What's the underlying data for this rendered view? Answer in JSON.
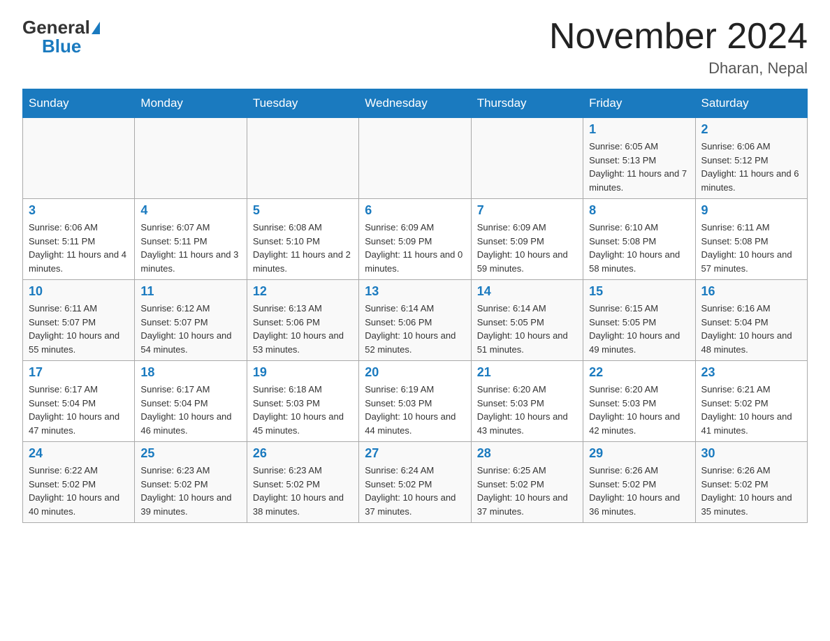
{
  "header": {
    "logo_text_general": "General",
    "logo_text_blue": "Blue",
    "month_title": "November 2024",
    "location": "Dharan, Nepal"
  },
  "weekdays": [
    "Sunday",
    "Monday",
    "Tuesday",
    "Wednesday",
    "Thursday",
    "Friday",
    "Saturday"
  ],
  "weeks": [
    [
      {
        "day": "",
        "info": ""
      },
      {
        "day": "",
        "info": ""
      },
      {
        "day": "",
        "info": ""
      },
      {
        "day": "",
        "info": ""
      },
      {
        "day": "",
        "info": ""
      },
      {
        "day": "1",
        "info": "Sunrise: 6:05 AM\nSunset: 5:13 PM\nDaylight: 11 hours and 7 minutes."
      },
      {
        "day": "2",
        "info": "Sunrise: 6:06 AM\nSunset: 5:12 PM\nDaylight: 11 hours and 6 minutes."
      }
    ],
    [
      {
        "day": "3",
        "info": "Sunrise: 6:06 AM\nSunset: 5:11 PM\nDaylight: 11 hours and 4 minutes."
      },
      {
        "day": "4",
        "info": "Sunrise: 6:07 AM\nSunset: 5:11 PM\nDaylight: 11 hours and 3 minutes."
      },
      {
        "day": "5",
        "info": "Sunrise: 6:08 AM\nSunset: 5:10 PM\nDaylight: 11 hours and 2 minutes."
      },
      {
        "day": "6",
        "info": "Sunrise: 6:09 AM\nSunset: 5:09 PM\nDaylight: 11 hours and 0 minutes."
      },
      {
        "day": "7",
        "info": "Sunrise: 6:09 AM\nSunset: 5:09 PM\nDaylight: 10 hours and 59 minutes."
      },
      {
        "day": "8",
        "info": "Sunrise: 6:10 AM\nSunset: 5:08 PM\nDaylight: 10 hours and 58 minutes."
      },
      {
        "day": "9",
        "info": "Sunrise: 6:11 AM\nSunset: 5:08 PM\nDaylight: 10 hours and 57 minutes."
      }
    ],
    [
      {
        "day": "10",
        "info": "Sunrise: 6:11 AM\nSunset: 5:07 PM\nDaylight: 10 hours and 55 minutes."
      },
      {
        "day": "11",
        "info": "Sunrise: 6:12 AM\nSunset: 5:07 PM\nDaylight: 10 hours and 54 minutes."
      },
      {
        "day": "12",
        "info": "Sunrise: 6:13 AM\nSunset: 5:06 PM\nDaylight: 10 hours and 53 minutes."
      },
      {
        "day": "13",
        "info": "Sunrise: 6:14 AM\nSunset: 5:06 PM\nDaylight: 10 hours and 52 minutes."
      },
      {
        "day": "14",
        "info": "Sunrise: 6:14 AM\nSunset: 5:05 PM\nDaylight: 10 hours and 51 minutes."
      },
      {
        "day": "15",
        "info": "Sunrise: 6:15 AM\nSunset: 5:05 PM\nDaylight: 10 hours and 49 minutes."
      },
      {
        "day": "16",
        "info": "Sunrise: 6:16 AM\nSunset: 5:04 PM\nDaylight: 10 hours and 48 minutes."
      }
    ],
    [
      {
        "day": "17",
        "info": "Sunrise: 6:17 AM\nSunset: 5:04 PM\nDaylight: 10 hours and 47 minutes."
      },
      {
        "day": "18",
        "info": "Sunrise: 6:17 AM\nSunset: 5:04 PM\nDaylight: 10 hours and 46 minutes."
      },
      {
        "day": "19",
        "info": "Sunrise: 6:18 AM\nSunset: 5:03 PM\nDaylight: 10 hours and 45 minutes."
      },
      {
        "day": "20",
        "info": "Sunrise: 6:19 AM\nSunset: 5:03 PM\nDaylight: 10 hours and 44 minutes."
      },
      {
        "day": "21",
        "info": "Sunrise: 6:20 AM\nSunset: 5:03 PM\nDaylight: 10 hours and 43 minutes."
      },
      {
        "day": "22",
        "info": "Sunrise: 6:20 AM\nSunset: 5:03 PM\nDaylight: 10 hours and 42 minutes."
      },
      {
        "day": "23",
        "info": "Sunrise: 6:21 AM\nSunset: 5:02 PM\nDaylight: 10 hours and 41 minutes."
      }
    ],
    [
      {
        "day": "24",
        "info": "Sunrise: 6:22 AM\nSunset: 5:02 PM\nDaylight: 10 hours and 40 minutes."
      },
      {
        "day": "25",
        "info": "Sunrise: 6:23 AM\nSunset: 5:02 PM\nDaylight: 10 hours and 39 minutes."
      },
      {
        "day": "26",
        "info": "Sunrise: 6:23 AM\nSunset: 5:02 PM\nDaylight: 10 hours and 38 minutes."
      },
      {
        "day": "27",
        "info": "Sunrise: 6:24 AM\nSunset: 5:02 PM\nDaylight: 10 hours and 37 minutes."
      },
      {
        "day": "28",
        "info": "Sunrise: 6:25 AM\nSunset: 5:02 PM\nDaylight: 10 hours and 37 minutes."
      },
      {
        "day": "29",
        "info": "Sunrise: 6:26 AM\nSunset: 5:02 PM\nDaylight: 10 hours and 36 minutes."
      },
      {
        "day": "30",
        "info": "Sunrise: 6:26 AM\nSunset: 5:02 PM\nDaylight: 10 hours and 35 minutes."
      }
    ]
  ]
}
